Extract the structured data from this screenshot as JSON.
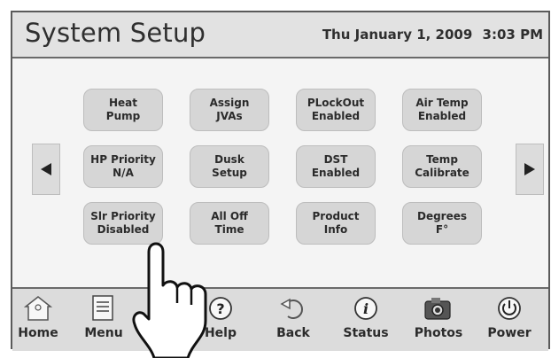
{
  "header": {
    "title": "System Setup",
    "date": "Thu January 1, 2009",
    "time": "3:03 PM"
  },
  "grid": {
    "buttons": [
      {
        "label": "Heat\nPump"
      },
      {
        "label": "Assign\nJVAs"
      },
      {
        "label": "PLockOut\nEnabled"
      },
      {
        "label": "Air Temp\nEnabled"
      },
      {
        "label": "HP Priority\nN/A"
      },
      {
        "label": "Dusk\nSetup"
      },
      {
        "label": "DST\nEnabled"
      },
      {
        "label": "Temp\nCalibrate"
      },
      {
        "label": "Slr Priority\nDisabled"
      },
      {
        "label": "All Off\nTime"
      },
      {
        "label": "Product\nInfo"
      },
      {
        "label": "Degrees\nF°"
      }
    ]
  },
  "nav": {
    "left_icon": "left-arrow-icon",
    "right_icon": "right-arrow-icon"
  },
  "toolbar": {
    "items": [
      {
        "label": "Home",
        "icon": "home-icon"
      },
      {
        "label": "Menu",
        "icon": "menu-icon"
      },
      {
        "label": "ch",
        "icon": "switch-icon"
      },
      {
        "label": "Help",
        "icon": "help-icon"
      },
      {
        "label": "Back",
        "icon": "back-icon"
      },
      {
        "label": "Status",
        "icon": "status-icon"
      },
      {
        "label": "Photos",
        "icon": "photos-icon"
      },
      {
        "label": "Power",
        "icon": "power-icon"
      }
    ]
  },
  "colors": {
    "button_bg": "#d6d6d6",
    "header_bg": "#e2e2e2",
    "text": "#2f2f2f"
  }
}
